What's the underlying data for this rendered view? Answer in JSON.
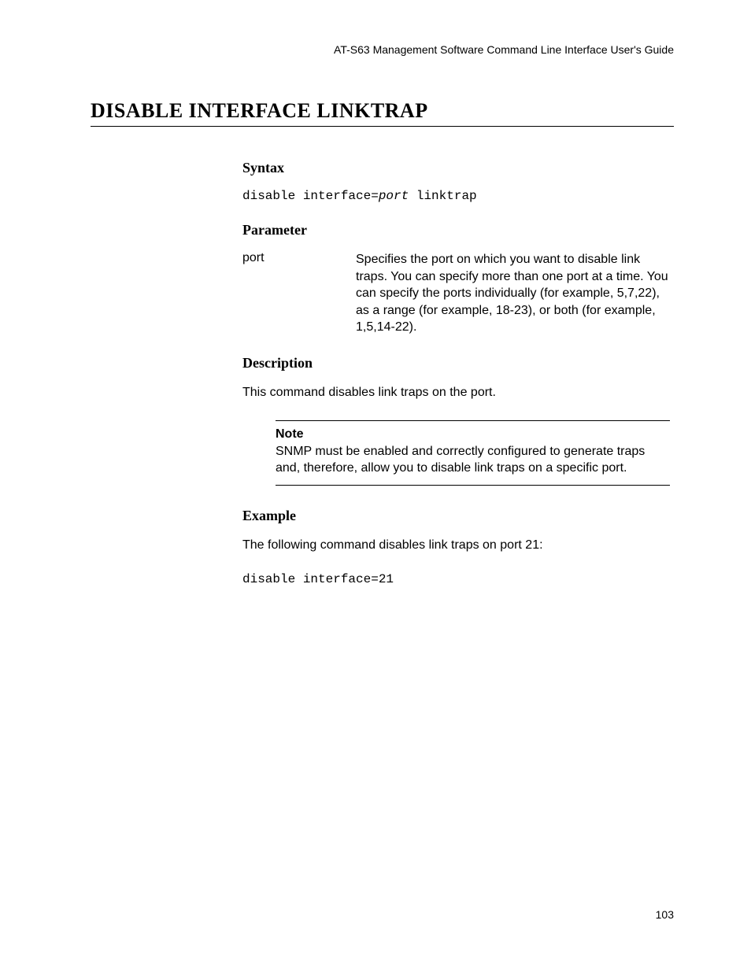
{
  "header": "AT-S63 Management Software Command Line Interface User's Guide",
  "title": "DISABLE INTERFACE LINKTRAP",
  "syntax": {
    "heading": "Syntax",
    "code_prefix": "disable interface=",
    "code_param": "port",
    "code_suffix": " linktrap"
  },
  "parameter": {
    "heading": "Parameter",
    "name": "port",
    "description": "Specifies the port on which you want to disable link traps. You can specify more than one port at a time. You can specify the ports individually (for example, 5,7,22), as a range (for example, 18-23), or both (for example, 1,5,14-22)."
  },
  "description": {
    "heading": "Description",
    "text": "This command disables link traps on the port."
  },
  "note": {
    "label": "Note",
    "text": "SNMP must be enabled and correctly configured to generate traps and, therefore, allow you to disable link traps on a specific port."
  },
  "example": {
    "heading": "Example",
    "intro": "The following command disables link traps on port 21:",
    "code": "disable interface=21"
  },
  "page_number": "103"
}
